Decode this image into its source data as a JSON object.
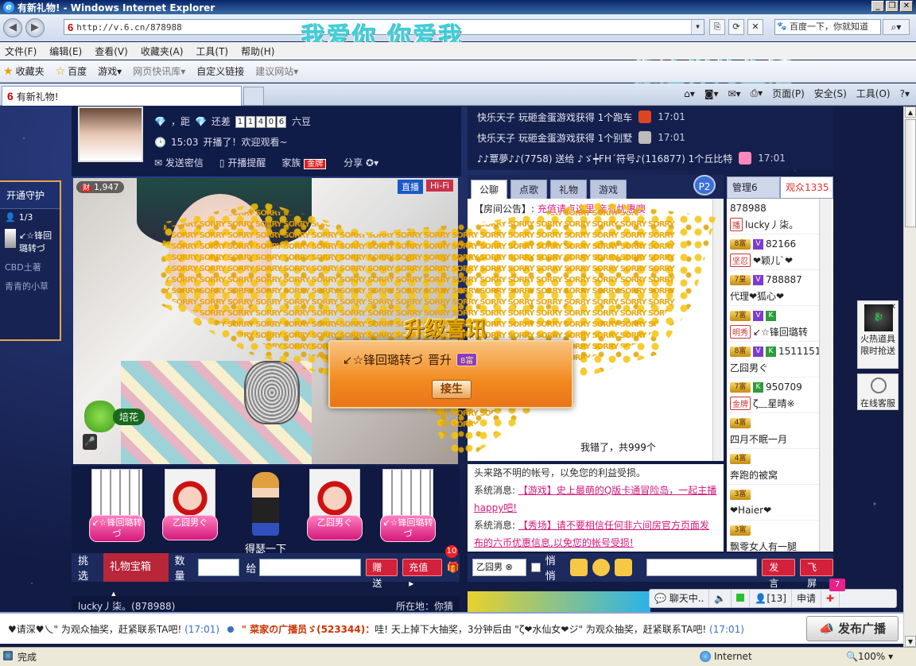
{
  "browser": {
    "title": "有新礼物!  - Windows Internet Explorer",
    "url": "http://v.6.cn/878988",
    "search_placeholder": "百度一下，你就知道",
    "menu": [
      "文件(F)",
      "编辑(E)",
      "查看(V)",
      "收藏夹(A)",
      "工具(T)",
      "帮助(H)"
    ],
    "favorites": [
      "收藏夹",
      "百度",
      "游戏",
      "网页快讯库",
      "自定义链接",
      "建议网站"
    ],
    "tab_title": "有新礼物!",
    "commands": [
      "页面(P)",
      "安全(S)",
      "工具(O)"
    ],
    "status": "完成",
    "zone": "Internet",
    "zoom": "100%"
  },
  "overlay": {
    "line1": "我爱你  你爱我",
    "line2": "像这样的生活"
  },
  "guard": {
    "title": "开通守护",
    "count": "1/3",
    "members": [
      "↙☆锋回璐转づ",
      "CBD土著",
      "青青的小草"
    ]
  },
  "anchor": {
    "distance_label": "，距",
    "still_short": "还差",
    "digits": [
      "1",
      "1",
      "4",
      "0",
      "6"
    ],
    "unit": "六豆",
    "time": "15:03",
    "live_msg": "开播了！欢迎观看~",
    "send_msg": "发送密信",
    "remind": "开播提醒",
    "family": "家族",
    "family_tag": "金牌",
    "share": "分享",
    "wealth": "1,947",
    "wealth_icon": "财",
    "live_label": "直播",
    "hifi_label": "Hi-Fi",
    "peihua": "培花"
  },
  "upgrade": {
    "title": "升级喜讯",
    "user": "↙☆锋回璐转づ",
    "verb": "晋升",
    "level": "8富",
    "button": "接生"
  },
  "swarm": {
    "label": "SORRY",
    "summary": "我错了，共999个"
  },
  "gifts": [
    {
      "kind": "bldg",
      "tag": "↙☆锋回璐转づ"
    },
    {
      "kind": "baby",
      "tag": "乙囧男ぐ"
    },
    {
      "kind": "baby",
      "tag": "乙囧男ぐ"
    },
    {
      "kind": "bldg",
      "tag": "↙☆锋回璐转づ"
    }
  ],
  "gift_doll_label": "得瑟一下",
  "giftbar": {
    "pick": "挑选",
    "category": "礼物宝箱",
    "qty": "数量",
    "to": "给",
    "give": "赠送",
    "recharge": "充值",
    "notif": "10"
  },
  "room": {
    "name": "lucky丿柒。(878988)",
    "location": "所在地：你猜"
  },
  "feed": [
    {
      "text": "快乐天子 玩砸金蛋游戏获得 1个跑车",
      "time": "17:01",
      "icon": "car"
    },
    {
      "text": "快乐天子 玩砸金蛋游戏获得 1个别墅",
      "time": "17:01",
      "icon": "house"
    },
    {
      "text": "♪♪覃夢♪♪(7758) 送给 ♪ゞ┿FH´符号♪(116877) 1个丘比特",
      "time": "17:01",
      "icon": "fairy"
    }
  ],
  "chat_tabs": [
    "公聊",
    "点歌",
    "礼物",
    "游戏"
  ],
  "p2": "P2",
  "notice": {
    "label": "【房间公告】:",
    "text": "充值请点这里  亲有忧惠噢"
  },
  "sys": [
    {
      "plain": "头来路不明的帐号，以免您的利益受损。",
      "pink": ""
    },
    {
      "plain": "系统消息: ",
      "pink": "【游戏】史上最萌的Q版卡通冒险岛，一起主播happy吧!"
    },
    {
      "plain": "系统消息: ",
      "pink": "【秀场】请不要相信任何非六间房官方页面发布的六币优惠信息,以免您的帐号受损!"
    }
  ],
  "member_tabs": [
    "管理6",
    "观众1335"
  ],
  "members": [
    {
      "l1": "878988",
      "l2": "lucky丿柒。",
      "tag": "播",
      "crown": "",
      "v": false,
      "k": false
    },
    {
      "l1": "82166",
      "l2": "❤颖儿`❤",
      "tag": "坚忍",
      "crown": "8富",
      "v": true,
      "k": false
    },
    {
      "l1": "788887",
      "l2": "代理❤狐心❤",
      "tag": "",
      "crown": "7皇",
      "v": true,
      "k": false
    },
    {
      "l1": "",
      "l2": "↙☆锋回璐转",
      "tag": "明秀",
      "crown": "7富",
      "v": true,
      "k": true
    },
    {
      "l1": "1511151",
      "l2": "乙囧男ぐ",
      "tag": "",
      "crown": "8富",
      "v": true,
      "k": true
    },
    {
      "l1": "950709",
      "l2": "ζ﹏星晴※",
      "tag": "金牌",
      "crown": "7富",
      "v": false,
      "k": true
    },
    {
      "l1": "",
      "l2": "四月不眠一月",
      "tag": "",
      "crown": "4富",
      "v": false,
      "k": false
    },
    {
      "l1": "",
      "l2": "奔跑的被窝",
      "tag": "",
      "crown": "4富",
      "v": false,
      "k": false
    },
    {
      "l1": "",
      "l2": "❤Haier❤",
      "tag": "",
      "crown": "3富",
      "v": false,
      "k": false
    },
    {
      "l1": "",
      "l2": "飘零女人有一腿",
      "tag": "",
      "crown": "3富",
      "v": false,
      "k": false
    }
  ],
  "chatinput": {
    "target": "乙囧男",
    "quiet": "悄悄",
    "send": "发言",
    "fly": "飞屏"
  },
  "widgets": {
    "hot_line1": "火热道具",
    "hot_line2": "限时抢送",
    "service": "在线客服"
  },
  "imbar": {
    "chatting": "聊天中..",
    "count": "[13]",
    "apply": "申请",
    "badge": "7"
  },
  "ticker": {
    "seg1": "♥请深♥乀\" 为观众抽奖，赶紧联系TA吧!",
    "time1": "(17:01)",
    "seg2_red": "\" 菜家の广播员ゞ(523344)：",
    "seg2": "哇! 天上掉下大抽奖，3分钟后由 \"ζ❤水仙女❤ジ\" 为观众抽奖，赶紧联系TA吧!",
    "time2": "(17:01)",
    "button": "发布广播"
  }
}
